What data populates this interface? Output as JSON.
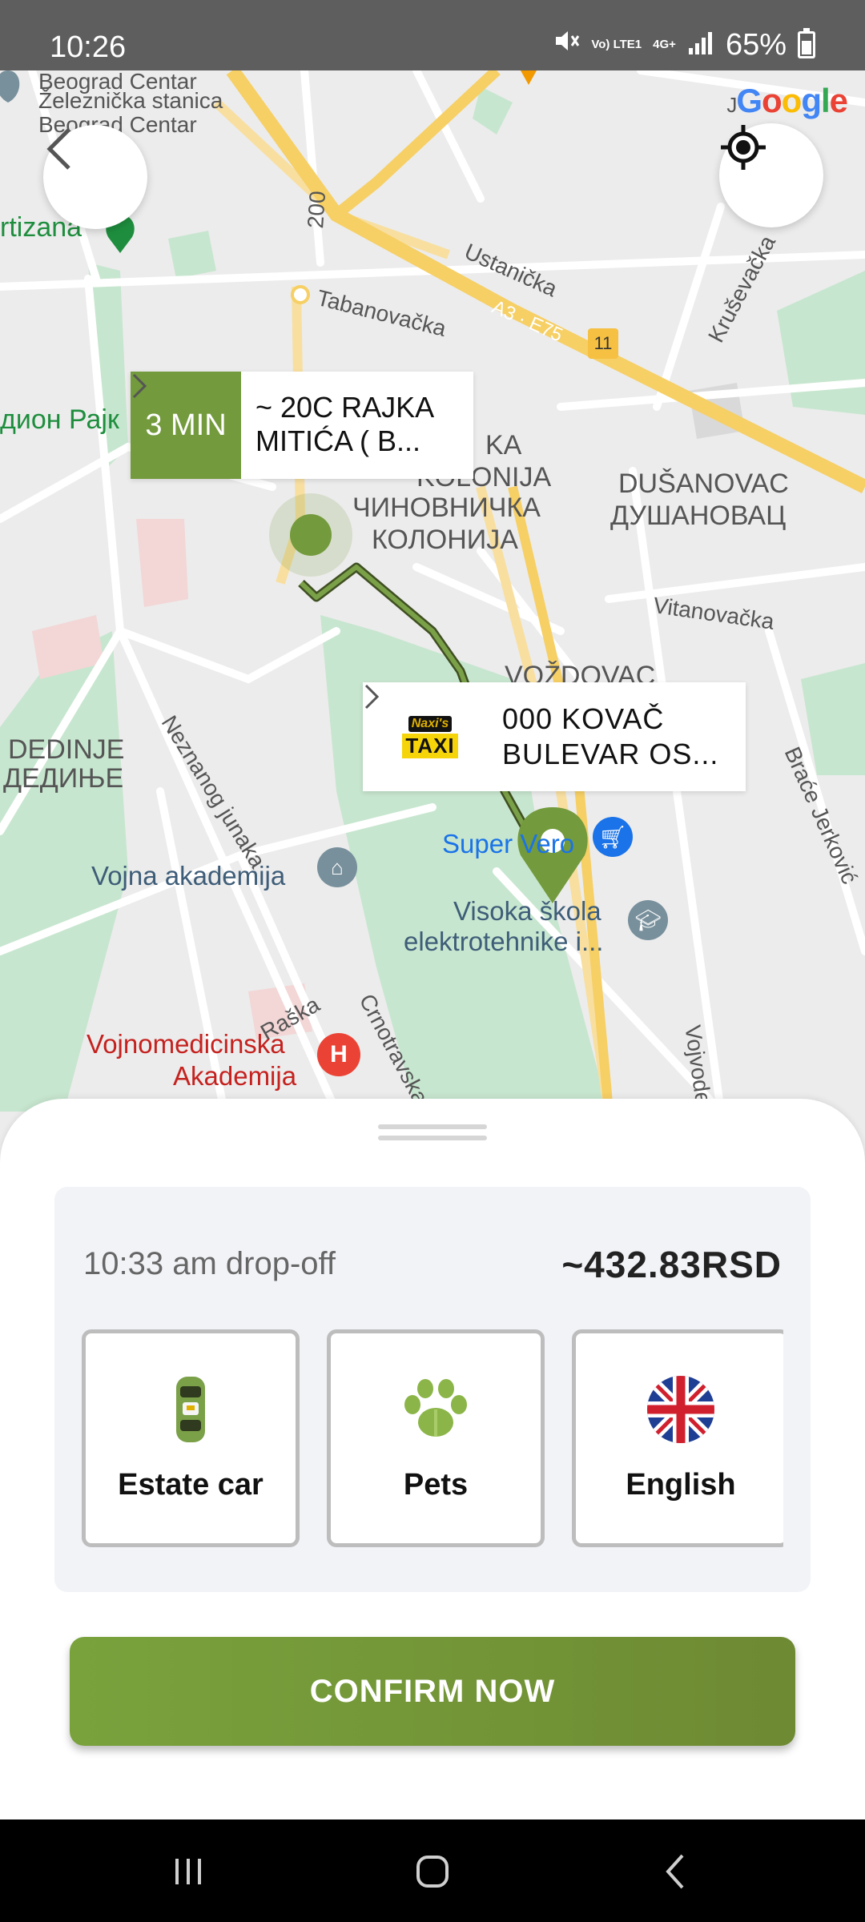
{
  "status_bar": {
    "time": "10:26",
    "network_top": "Vo) LTE1",
    "network_type": "4G+",
    "battery": "65%"
  },
  "map": {
    "labels": {
      "station_line1": "Beograd Centar",
      "station_line2": "Železnička stanica",
      "station_line3": "Beograd Centar",
      "partizana": "rtizana",
      "stadium": "дион Рајк",
      "road_200": "200",
      "tabanovacka": "Tabanovačka",
      "ustanicka": "Ustanička",
      "highway": "A3 · E75",
      "road_11": "11",
      "krusevacka": "Kruševačka",
      "kolonija_top": "KA",
      "kolonija_lat": "KOLONIJA",
      "chinovnichka_1": "ЧИНОВНИЧКА",
      "chinovnichka_2": "КОЛОНИЈА",
      "dusanovac_lat": "DUŠANOVAC",
      "dusanovac_cyr": "ДУШАНОВАЦ",
      "vitanovacka": "Vitanovačka",
      "vozdovac": "VOŽDOVAC",
      "dedinje_lat": "DEDINJE",
      "dedinje_cyr": "ДЕДИЊЕ",
      "neznanog_junaka": "Neznanog junaka",
      "brace_jerkovic": "Braće Jerković",
      "super_vero": "Super Vero",
      "vojna_akademija": "Vojna akademija",
      "visoka_skola_1": "Visoka škola",
      "visoka_skola_2": "elektrotehnike i...",
      "raska": "Raška",
      "crnotravska": "Crnotravska",
      "vojnomedicinska_1": "Vojnomedicinska",
      "vojnomedicinska_2": "Akademija",
      "vojvode": "Vojvode",
      "google_prefix": "J"
    },
    "google_letters": [
      "G",
      "o",
      "o",
      "g",
      "l",
      "e"
    ],
    "eta_card": {
      "badge": "3 MIN",
      "line1": "~ 20C RAJKA",
      "line2": "MITIĆA ( B..."
    },
    "dest_card": {
      "logo_top": "Naxi's",
      "logo_bottom": "TAXI",
      "line1": "000 KOVAČ",
      "line2": "BULEVAR OS..."
    },
    "colors": {
      "route": "#556b2f",
      "pin": "#739a3c",
      "park": "#c7e6cf",
      "highway": "#f6cf65"
    }
  },
  "sheet": {
    "dropoff": "10:33 am drop-off",
    "price": "~432.83RSD",
    "options": [
      {
        "label": "Estate car",
        "icon": "car-icon"
      },
      {
        "label": "Pets",
        "icon": "paw-icon"
      },
      {
        "label": "English",
        "icon": "uk-flag-icon"
      }
    ],
    "confirm_label": "CONFIRM NOW"
  }
}
